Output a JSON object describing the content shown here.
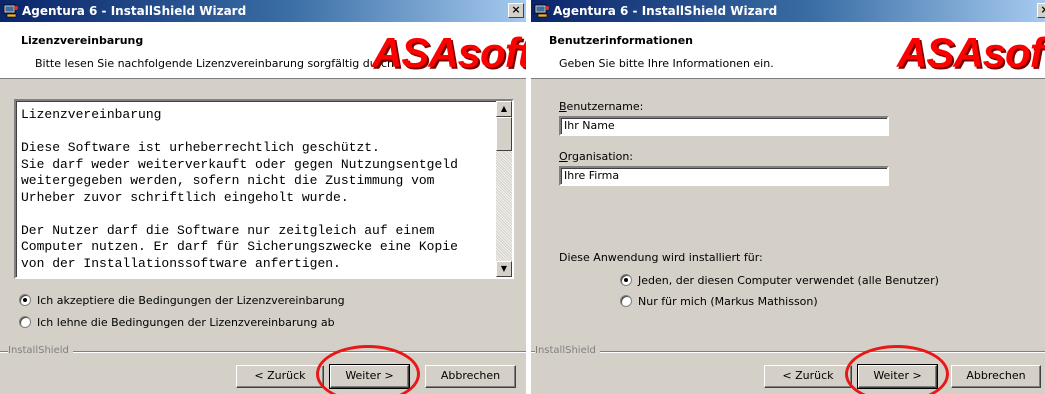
{
  "left": {
    "title": "Agentura 6 - InstallShield Wizard",
    "close_label": "×",
    "header_title": "Lizenzvereinbarung",
    "header_subtitle": "Bitte lesen Sie nachfolgende Lizenzvereinbarung sorgfältig durch.",
    "logo": "ASAsoft",
    "license_text": "Lizenzvereinbarung\n\nDiese Software ist urheberrechtlich geschützt.\nSie darf weder weiterverkauft oder gegen Nutzungsentgeld\nweitergegeben werden, sofern nicht die Zustimmung vom\nUrheber zuvor schriftlich eingeholt wurde.\n\nDer Nutzer darf die Software nur zeitgleich auf einem\nComputer nutzen. Er darf für Sicherungszwecke eine Kopie\nvon der Installationssoftware anfertigen.",
    "radio_accept": "Ich akzeptiere die Bedingungen der Lizenzvereinbarung",
    "radio_decline": "Ich lehne die Bedingungen der Lizenzvereinbarung ab",
    "radio_selected": "accept",
    "installshield": "InstallShield",
    "back_label": "< Zurück",
    "next_label": "Weiter >",
    "cancel_label": "Abbrechen"
  },
  "right": {
    "title": "Agentura 6 - InstallShield Wizard",
    "close_label": "×",
    "header_title": "Benutzerinformationen",
    "header_subtitle": "Geben Sie bitte Ihre Informationen ein.",
    "logo": "ASAsoft",
    "username_label_accel": "B",
    "username_label_rest": "enutzername:",
    "username_value": "Ihr Name",
    "org_label_accel": "O",
    "org_label_rest": "rganisation:",
    "org_value": "Ihre Firma",
    "install_for_label": "Diese Anwendung wird installiert für:",
    "radio_all": "Jeden, der diesen Computer verwendet (alle Benutzer)",
    "radio_me": "Nur für mich (Markus Mathisson)",
    "radio_selected": "all",
    "installshield": "InstallShield",
    "back_label": "< Zurück",
    "next_label": "Weiter >",
    "cancel_label": "Abbrechen"
  },
  "colors": {
    "title_bar": "#0a246a",
    "dialog_bg": "#d4d0c8",
    "logo": "#ff0000",
    "highlight_ellipse": "#e81818"
  },
  "icons": {
    "app": "installer-computer-icon",
    "scroll_up": "scroll-up-arrow-icon",
    "scroll_down": "scroll-down-arrow-icon"
  }
}
